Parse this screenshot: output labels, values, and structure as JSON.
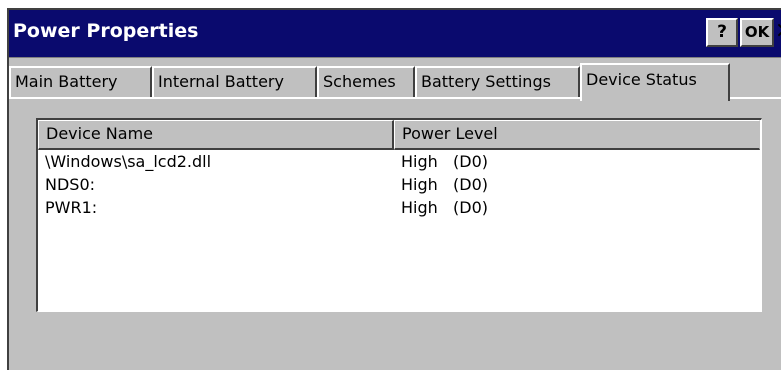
{
  "window": {
    "title": "Power Properties",
    "help_label": "?",
    "ok_label": "OK",
    "close_label": "×"
  },
  "tabs": [
    {
      "label": "Main Battery",
      "active": false
    },
    {
      "label": "Internal Battery",
      "active": false
    },
    {
      "label": "Schemes",
      "active": false
    },
    {
      "label": "Battery Settings",
      "active": false
    },
    {
      "label": "Device Status",
      "active": true
    }
  ],
  "device_list": {
    "columns": {
      "name": "Device Name",
      "level": "Power Level"
    },
    "rows": [
      {
        "name": "\\Windows\\sa_lcd2.dll",
        "level": "High   (D0)"
      },
      {
        "name": "NDS0:",
        "level": "High   (D0)"
      },
      {
        "name": "PWR1:",
        "level": "High   (D0)"
      }
    ]
  },
  "colors": {
    "titlebar": "#0a0a6e",
    "face": "#c0c0c0",
    "list_bg": "#ffffff"
  }
}
